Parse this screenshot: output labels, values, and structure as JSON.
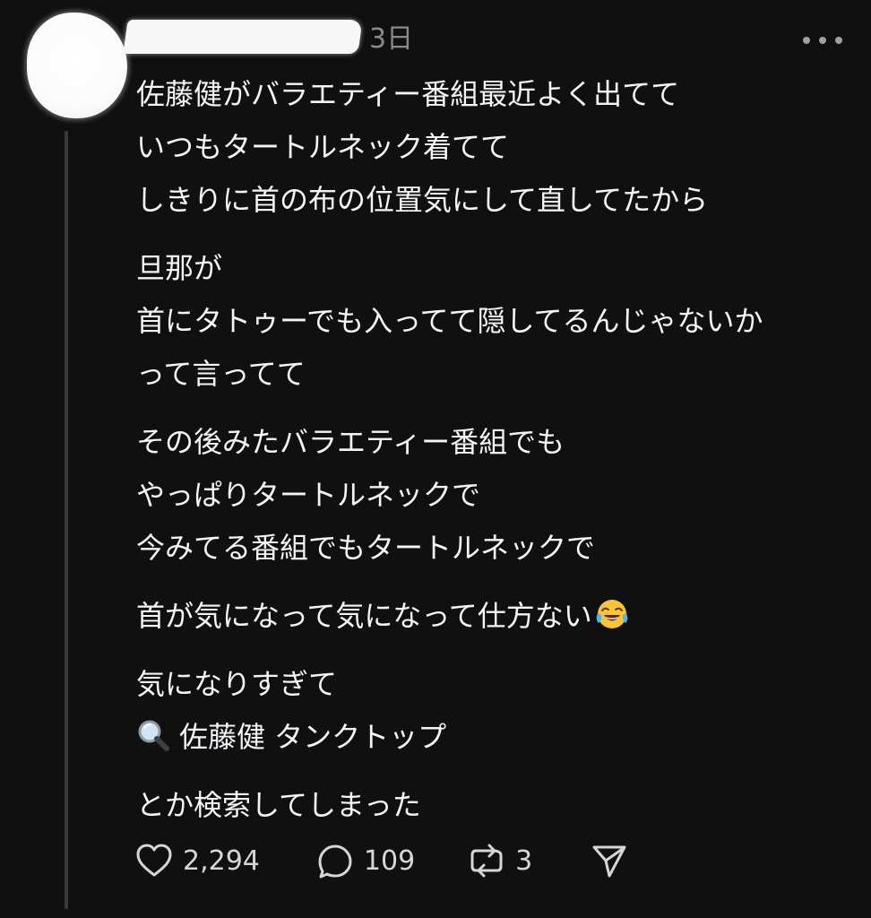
{
  "post": {
    "timestamp": "3日",
    "paragraphs": [
      [
        "佐藤健がバラエティー番組最近よく出てて",
        "いつもタートルネック着てて",
        "しきりに首の布の位置気にして直してたから"
      ],
      [
        "旦那が",
        "首にタトゥーでも入ってて隠してるんじゃないか",
        "って言ってて"
      ],
      [
        "その後みたバラエティー番組でも",
        "やっぱりタートルネックで",
        "今みてる番組でもタートルネックで"
      ],
      [
        "首が気になって気になって仕方ない"
      ],
      [
        "気になりすぎて",
        "佐藤健 タンクトップ"
      ],
      [
        "とか検索してしまった"
      ]
    ],
    "emoji_after_p4": "face-with-tears-of-joy",
    "emoji_before_search": "magnifying-glass"
  },
  "actions": {
    "likes": "2,294",
    "replies": "109",
    "reposts": "3"
  },
  "icons": {
    "like": "heart-icon",
    "reply": "speech-bubble-icon",
    "repost": "repost-icon",
    "share": "send-icon",
    "more": "more-horizontal-icon"
  },
  "colors": {
    "background": "#101010",
    "text": "#f3f5f7",
    "muted": "#8a8a8a",
    "thread_line": "#3a3a3a"
  }
}
